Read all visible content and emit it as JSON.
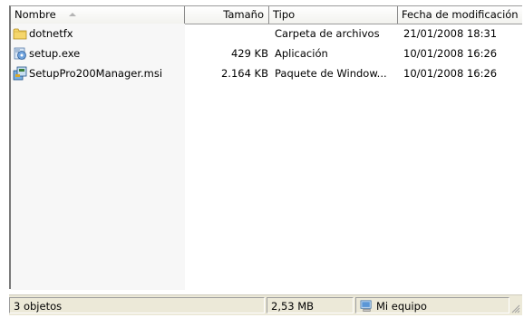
{
  "columns": {
    "name": "Nombre",
    "size": "Tamaño",
    "type": "Tipo",
    "date": "Fecha de modificación"
  },
  "files": [
    {
      "name": "dotnetfx",
      "size": "",
      "type": "Carpeta de archivos",
      "date": "21/01/2008 18:31",
      "icon": "folder-icon"
    },
    {
      "name": "setup.exe",
      "size": "429 KB",
      "type": "Aplicación",
      "date": "10/01/2008 16:26",
      "icon": "setup-exe-icon"
    },
    {
      "name": "SetupPro200Manager.msi",
      "size": "2.164 KB",
      "type": "Paquete de Window...",
      "date": "10/01/2008 16:26",
      "icon": "msi-package-icon"
    }
  ],
  "status": {
    "count": "3 objetos",
    "total_size": "2,53 MB",
    "location": "Mi equipo",
    "location_icon": "my-computer-icon"
  }
}
